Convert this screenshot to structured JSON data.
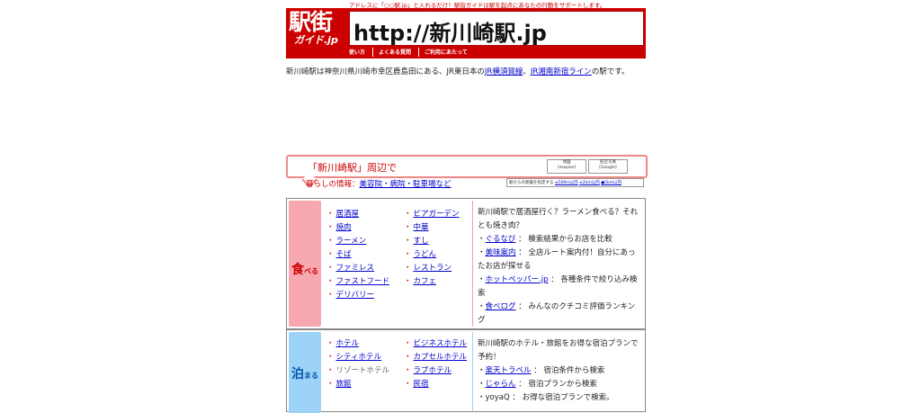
{
  "header": {
    "tagline": "アドレスに「○○駅.jp」と入れるだけ！駅街ガイドは駅を起点にあなたの行動をサポートします。",
    "logo_big": "駅街",
    "logo_small": "ガイド.jp",
    "url": "http://新川崎駅.jp",
    "nav": [
      "使い方",
      "よくある質問",
      "ご利用にあたって"
    ]
  },
  "intro": {
    "text_before": "新川崎駅は神奈川県川崎市幸区鹿島田にある、JR東日本の",
    "link1": "JR横須賀線",
    "sep": "、",
    "link2": "JR湘南新宿ライン",
    "text_after": "の駅です。"
  },
  "area": {
    "title": "「新川崎駅」周辺で",
    "map_btn1": [
      "地図",
      "[mapion]"
    ],
    "map_btn2": [
      "航空写真",
      "[Google]"
    ],
    "life_label": "暮らしの情報：",
    "life_link": "美容院・病院・駐車場など",
    "distance_label": "駅からの距離を指定する",
    "distance_opts": [
      "≤500m以内",
      "≤2km以内",
      "●5km以内"
    ]
  },
  "eat": {
    "side_main": "食",
    "side_sub": "べる",
    "col1": [
      "居酒屋",
      "焼肉",
      "ラーメン",
      "そば",
      "ファミレス",
      "ファストフード",
      "デリバリー"
    ],
    "col2": [
      "ビアガーデン",
      "中華",
      "すし",
      "うどん",
      "レストラン",
      "カフェ"
    ],
    "desc_intro": "新川崎駅で居酒屋行く？ラーメン食べる？それとも焼き肉？",
    "services": [
      {
        "name": "ぐるなび",
        "text": "： 検索結果からお店を比較"
      },
      {
        "name": "美味案内",
        "text": "： 全店ルート案内付！自分にあったお店が探せる"
      },
      {
        "name": "ホットペッパー.jp",
        "text": "： 各種条件で絞り込み検索"
      },
      {
        "name": "食べログ",
        "text": "： みんなのクチコミ評価ランキング"
      }
    ]
  },
  "stay": {
    "side_main": "泊",
    "side_sub": "まる",
    "col1": [
      "ホテル",
      "シティホテル",
      "リゾートホテル",
      "旅館"
    ],
    "col2": [
      "ビジネスホテル",
      "カプセルホテル",
      "ラブホテル",
      "民宿"
    ],
    "desc_intro": "新川崎駅のホテル・旅館をお得な宿泊プランで予約！",
    "services": [
      {
        "name": "楽天トラベル",
        "text": "： 宿泊条件から検索"
      },
      {
        "name": "じゃらん",
        "text": "： 宿泊プランから検索"
      },
      {
        "name": "yoyaQ",
        "text": "： お得な宿泊プランで検索。"
      }
    ]
  },
  "colors": {
    "brand_red": "#cc0000",
    "eat_side": "#f7a7b0",
    "stay_side": "#9cd3f7",
    "link": "#0000cc"
  }
}
